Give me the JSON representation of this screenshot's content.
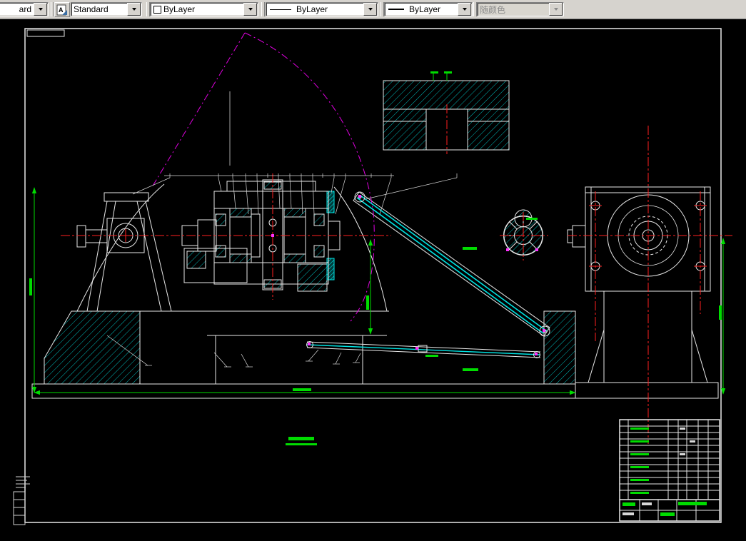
{
  "toolbar": {
    "dim_style_combo": {
      "value": "ard"
    },
    "text_style_button": {
      "icon": "text-style-icon",
      "glyph": "A"
    },
    "text_style_combo": {
      "value": "Standard"
    },
    "color_combo": {
      "value": "ByLayer",
      "swatch_color": "#ffffff"
    },
    "linetype_combo": {
      "value": "ByLayer"
    },
    "lineweight_combo": {
      "value": "ByLayer"
    },
    "plot_style_combo": {
      "value": "随颜色",
      "disabled": true
    }
  },
  "canvas": {
    "background": "#000000",
    "layer_colors": {
      "outline": "#f0f0f0",
      "hatch": "#00dcdc",
      "centerline": "#ff2020",
      "dimension": "#00dc00",
      "phantom": "#e000e0"
    }
  }
}
